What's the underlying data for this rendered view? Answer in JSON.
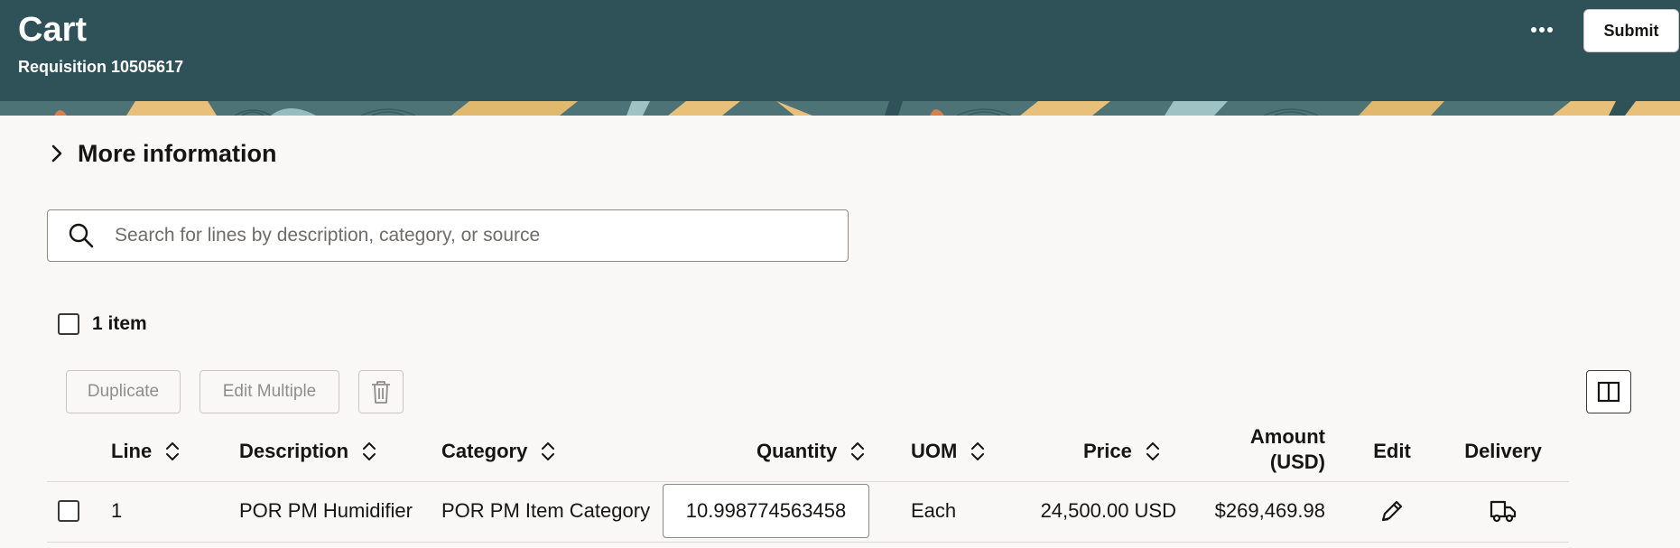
{
  "header": {
    "title": "Cart",
    "subtitle": "Requisition 10505617",
    "submit_label": "Submit"
  },
  "section": {
    "more_info_label": "More information"
  },
  "search": {
    "placeholder": "Search for lines by description, category, or source",
    "value": ""
  },
  "selection": {
    "count_label": "1 item"
  },
  "toolbar": {
    "duplicate_label": "Duplicate",
    "edit_multiple_label": "Edit Multiple"
  },
  "table": {
    "columns": {
      "line": "Line",
      "description": "Description",
      "category": "Category",
      "quantity": "Quantity",
      "uom": "UOM",
      "price": "Price",
      "amount_line1": "Amount",
      "amount_line2": "(USD)",
      "edit": "Edit",
      "delivery": "Delivery"
    },
    "rows": [
      {
        "line": "1",
        "description": "POR PM Humidifier",
        "category": "POR PM Item Category",
        "quantity": "10.998774563458",
        "uom": "Each",
        "price": "24,500.00 USD",
        "amount": "$269,469.98"
      }
    ]
  },
  "icons": {
    "more": "more-horizontal-icon",
    "expand": "chevron-right-icon",
    "search": "search-icon",
    "delete": "trash-icon",
    "panel": "columns-icon",
    "sort": "sort-icon",
    "edit": "pencil-icon",
    "delivery": "truck-icon"
  },
  "colors": {
    "header_bg": "#2f5158",
    "page_bg": "#f9f8f6",
    "text": "#161513",
    "disabled_text": "#908d89"
  }
}
